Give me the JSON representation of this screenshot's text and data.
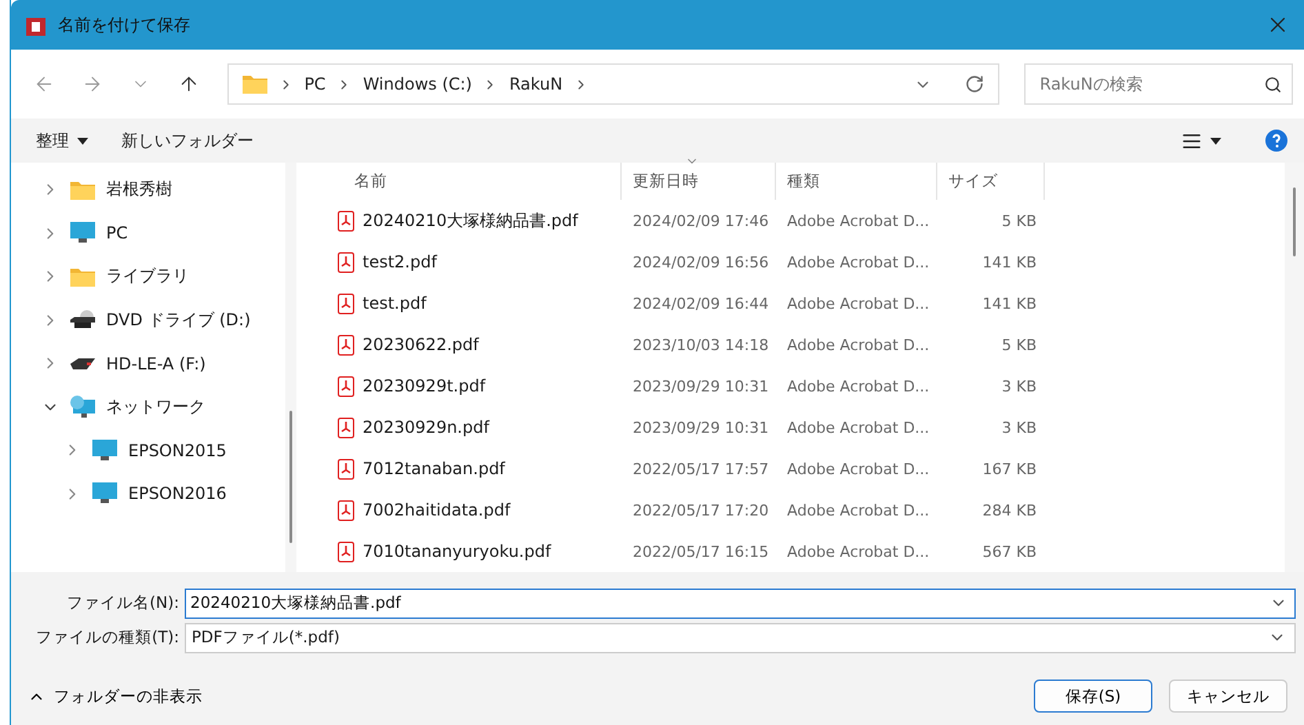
{
  "window": {
    "title": "名前を付けて保存"
  },
  "address": {
    "path": [
      "PC",
      "Windows (C:)",
      "RakuN"
    ]
  },
  "search": {
    "placeholder": "RakuNの検索"
  },
  "commands": {
    "organize": "整理",
    "new_folder": "新しいフォルダー"
  },
  "nav_tree": [
    {
      "label": "岩根秀樹",
      "kind": "folder",
      "expanded": false
    },
    {
      "label": "PC",
      "kind": "pc",
      "expanded": false
    },
    {
      "label": "ライブラリ",
      "kind": "folder",
      "expanded": false
    },
    {
      "label": "DVD ドライブ (D:)",
      "kind": "dvd",
      "expanded": false
    },
    {
      "label": "HD-LE-A (F:)",
      "kind": "hdd",
      "expanded": false
    },
    {
      "label": "ネットワーク",
      "kind": "network",
      "expanded": true,
      "children": [
        {
          "label": "EPSON2015",
          "kind": "pc",
          "expanded": false
        },
        {
          "label": "EPSON2016",
          "kind": "pc",
          "expanded": false
        }
      ]
    }
  ],
  "table": {
    "columns": [
      {
        "label": "名前",
        "sorted": false
      },
      {
        "label": "更新日時",
        "sorted": true
      },
      {
        "label": "種類",
        "sorted": false
      },
      {
        "label": "サイズ",
        "sorted": false
      }
    ],
    "rows": [
      [
        "20240210大塚様納品書.pdf",
        "2024/02/09 17:46",
        "Adobe Acrobat D...",
        "5 KB"
      ],
      [
        "test2.pdf",
        "2024/02/09 16:56",
        "Adobe Acrobat D...",
        "141 KB"
      ],
      [
        "test.pdf",
        "2024/02/09 16:44",
        "Adobe Acrobat D...",
        "141 KB"
      ],
      [
        "20230622.pdf",
        "2023/10/03 14:18",
        "Adobe Acrobat D...",
        "5 KB"
      ],
      [
        "20230929t.pdf",
        "2023/09/29 10:31",
        "Adobe Acrobat D...",
        "3 KB"
      ],
      [
        "20230929n.pdf",
        "2023/09/29 10:31",
        "Adobe Acrobat D...",
        "3 KB"
      ],
      [
        "7012tanaban.pdf",
        "2022/05/17 17:57",
        "Adobe Acrobat D...",
        "167 KB"
      ],
      [
        "7002haitidata.pdf",
        "2022/05/17 17:20",
        "Adobe Acrobat D...",
        "284 KB"
      ],
      [
        "7010tananyuryoku.pdf",
        "2022/05/17 16:15",
        "Adobe Acrobat D...",
        "567 KB"
      ]
    ]
  },
  "file_name": {
    "label": "ファイル名(N):",
    "value": "20240210大塚様納品書.pdf"
  },
  "file_type": {
    "label": "ファイルの種類(T):",
    "value": "PDFファイル(*.pdf)"
  },
  "footer": {
    "toggle": "フォルダーの非表示",
    "save": "保存(S)",
    "cancel": "キャンセル"
  }
}
